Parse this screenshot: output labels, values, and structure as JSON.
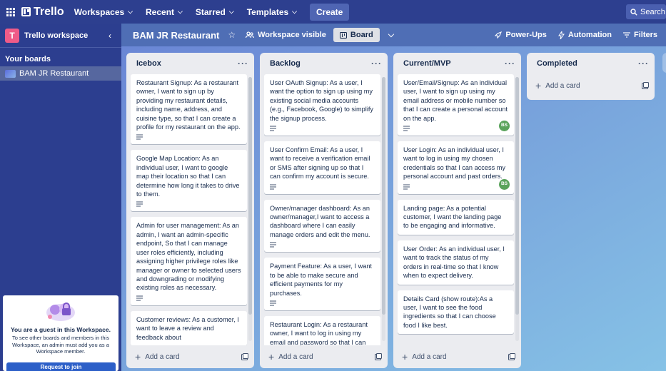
{
  "topbar": {
    "app_name": "Trello",
    "menus": [
      "Workspaces",
      "Recent",
      "Starred",
      "Templates"
    ],
    "create_label": "Create",
    "search_label": "Search"
  },
  "sidebar": {
    "workspace_initial": "T",
    "workspace_name": "Trello workspace",
    "your_boards_label": "Your boards",
    "boards": [
      "BAM JR Restaurant"
    ],
    "guest_title": "You are a guest in this Workspace.",
    "guest_text": "To see other boards and members in this Workspace, an admin must add you as a Workspace member.",
    "request_label": "Request to join"
  },
  "boardbar": {
    "title": "BAM JR Restaurant",
    "visibility": "Workspace visible",
    "view_label": "Board",
    "power_ups": "Power-Ups",
    "automation": "Automation",
    "filters": "Filters"
  },
  "lists": [
    {
      "name": "Icebox",
      "add_label": "Add a card",
      "cards": [
        {
          "text": "Restaurant Signup: As a restaurant owner, I want to sign up by providing my restaurant details, including name, address, and cuisine type, so that I can create a profile for my restaurant on the app.",
          "member": ""
        },
        {
          "text": "Google Map Location: As an individual user, I want to google map their location so that I can determine how long it takes to drive to them.",
          "member": ""
        },
        {
          "text": "Admin for user management: As an admin, I want an admin-specific endpoint, So that I can manage user roles efficiently, including assigning higher privilege roles like manager or owner to selected users and downgrading or modifying existing roles as necessary.",
          "member": ""
        },
        {
          "text": "Customer reviews: As a customer, I want to leave a review and feedback about",
          "member": ""
        }
      ]
    },
    {
      "name": "Backlog",
      "add_label": "Add a card",
      "cards": [
        {
          "text": "User OAuth Signup: As a user, I want the option to sign up using my existing social media accounts (e.g., Facebook, Google) to simplify the signup process.",
          "member": ""
        },
        {
          "text": "User Confirm Email: As a user, I want to receive a verification email or SMS after signing up so that I can confirm my account is secure.",
          "member": ""
        },
        {
          "text": "Owner/manager dashboard: As an owner/manager,I want to access a dashboard where I can easily manage orders and edit the menu.",
          "member": ""
        },
        {
          "text": "Payment Feature: As a user, I want to be able to make secure and efficient payments for my purchases.",
          "member": ""
        },
        {
          "text": "Restaurant Login: As a restaurant owner, I want to log in using my email and password so that I can",
          "member": ""
        }
      ]
    },
    {
      "name": "Current/MVP",
      "add_label": "Add a card",
      "cards": [
        {
          "text": "User/Email/Signup: As an individual user, I want to sign up using my email address or mobile number so that I can create a personal account on the app.",
          "member": "BS"
        },
        {
          "text": "User Login: As an individual user, I want to log in using my chosen credentials so that I can access my personal account and past orders.",
          "member": "BS"
        },
        {
          "text": "Landing page: As a potential customer, I want the landing page to be engaging and informative.",
          "member": ""
        },
        {
          "text": "User Order: As an individual user, I want to track the status of my orders in real-time so that I know when to expect delivery.",
          "member": ""
        },
        {
          "text": "Details Card (show route):As a user, I want to see the food ingredients so that I can choose food I like best.",
          "member": ""
        }
      ]
    },
    {
      "name": "Completed",
      "add_label": "Add a card",
      "cards": []
    }
  ]
}
